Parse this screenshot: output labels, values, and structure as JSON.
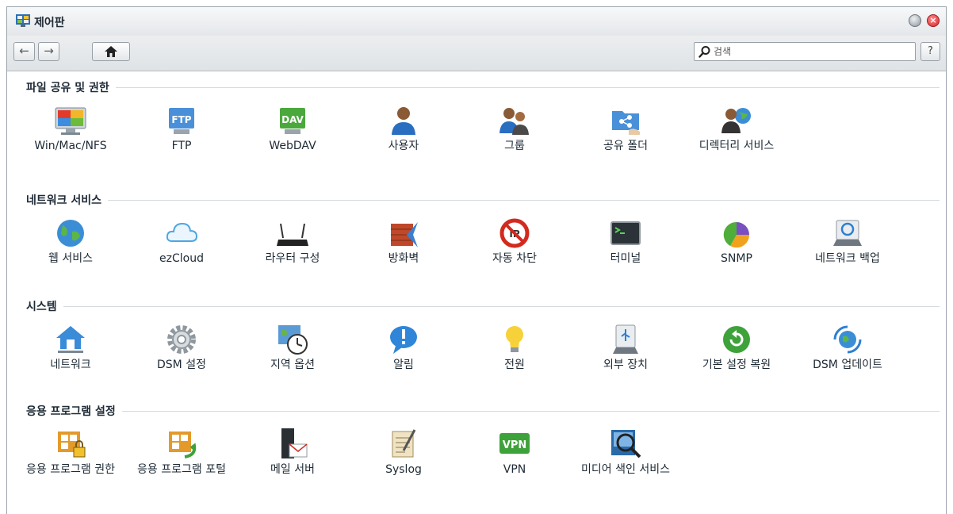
{
  "window": {
    "title": "제어판"
  },
  "toolbar": {
    "back_label": "←",
    "forward_label": "→",
    "home_label": "⌂",
    "search_placeholder": "검색",
    "search_value": "",
    "help_label": "?"
  },
  "sections": [
    {
      "title": "파일 공유 및 권한",
      "items": [
        {
          "label": "Win/Mac/NFS",
          "icon": "monitor-icon"
        },
        {
          "label": "FTP",
          "icon": "ftp-folder-icon"
        },
        {
          "label": "WebDAV",
          "icon": "dav-folder-icon"
        },
        {
          "label": "사용자",
          "icon": "user-icon"
        },
        {
          "label": "그룹",
          "icon": "group-icon"
        },
        {
          "label": "공유 폴더",
          "icon": "shared-folder-icon"
        },
        {
          "label": "디렉터리 서비스",
          "icon": "directory-service-icon"
        }
      ]
    },
    {
      "title": "네트워크 서비스",
      "items": [
        {
          "label": "웹 서비스",
          "icon": "globe-icon"
        },
        {
          "label": "ezCloud",
          "icon": "cloud-icon"
        },
        {
          "label": "라우터 구성",
          "icon": "router-icon"
        },
        {
          "label": "방화벽",
          "icon": "firewall-icon"
        },
        {
          "label": "자동 차단",
          "icon": "block-icon"
        },
        {
          "label": "터미널",
          "icon": "terminal-icon"
        },
        {
          "label": "SNMP",
          "icon": "pie-chart-icon"
        },
        {
          "label": "네트워크 백업",
          "icon": "network-backup-icon"
        }
      ]
    },
    {
      "title": "시스템",
      "items": [
        {
          "label": "네트워크",
          "icon": "home-network-icon"
        },
        {
          "label": "DSM 설정",
          "icon": "gear-icon"
        },
        {
          "label": "지역 옵션",
          "icon": "clock-map-icon"
        },
        {
          "label": "알림",
          "icon": "notification-icon"
        },
        {
          "label": "전원",
          "icon": "lightbulb-icon"
        },
        {
          "label": "외부 장치",
          "icon": "usb-device-icon"
        },
        {
          "label": "기본 설정 복원",
          "icon": "restore-icon"
        },
        {
          "label": "DSM 업데이트",
          "icon": "update-icon"
        }
      ]
    },
    {
      "title": "응용 프로그램 설정",
      "items": [
        {
          "label": "응용 프로그램 권한",
          "icon": "app-privilege-icon"
        },
        {
          "label": "응용 프로그램 포털",
          "icon": "app-portal-icon"
        },
        {
          "label": "메일 서버",
          "icon": "mail-server-icon"
        },
        {
          "label": "Syslog",
          "icon": "syslog-icon"
        },
        {
          "label": "VPN",
          "icon": "vpn-icon"
        },
        {
          "label": "미디어 색인 서비스",
          "icon": "media-index-icon"
        }
      ]
    }
  ]
}
